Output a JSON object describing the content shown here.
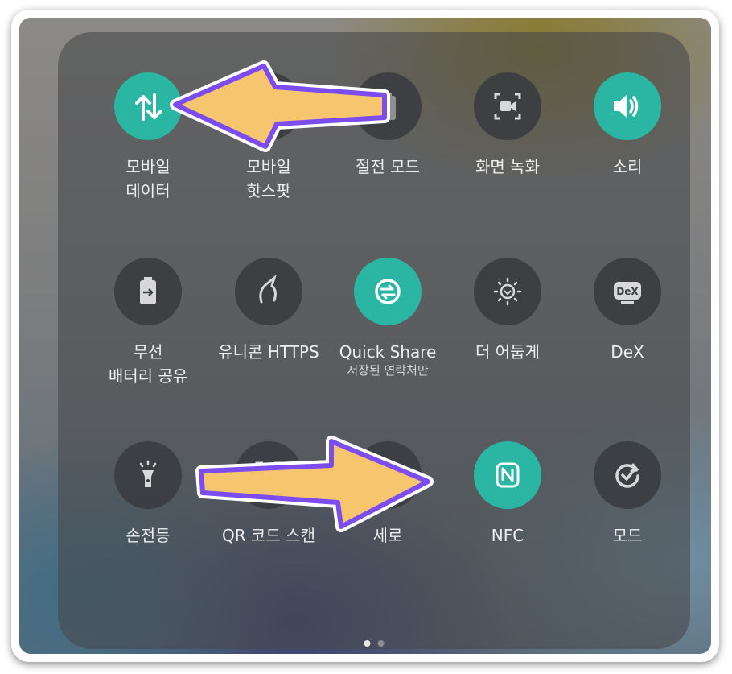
{
  "tiles": [
    {
      "id": "mobile-data",
      "icon": "arrows-up-down-icon",
      "on": true,
      "label": [
        "모바일",
        "데이터"
      ]
    },
    {
      "id": "hotspot",
      "icon": "hotspot-icon",
      "on": false,
      "label": [
        "모바일",
        "핫스팟"
      ]
    },
    {
      "id": "power-saving",
      "icon": "battery-icon",
      "on": false,
      "label": [
        "절전 모드"
      ]
    },
    {
      "id": "screen-record",
      "icon": "screen-record-icon",
      "on": false,
      "label": [
        "화면 녹화"
      ]
    },
    {
      "id": "sound",
      "icon": "speaker-icon",
      "on": true,
      "label": [
        "소리"
      ]
    },
    {
      "id": "wireless-share",
      "icon": "wireless-battery-share-icon",
      "on": false,
      "label": [
        "무선",
        "배터리 공유"
      ]
    },
    {
      "id": "unicorn-https",
      "icon": "unicorn-icon",
      "on": false,
      "label": [
        "유니콘 HTTPS"
      ]
    },
    {
      "id": "quick-share",
      "icon": "quick-share-icon",
      "on": true,
      "label": [
        "Quick Share"
      ],
      "sub": "저장된 연락처만"
    },
    {
      "id": "extra-dim",
      "icon": "extra-dim-icon",
      "on": false,
      "label": [
        "더 어둡게"
      ]
    },
    {
      "id": "dex",
      "icon": "dex-icon",
      "on": false,
      "label": [
        "DeX"
      ]
    },
    {
      "id": "flashlight",
      "icon": "flashlight-icon",
      "on": false,
      "label": [
        "손전등"
      ]
    },
    {
      "id": "qr-scan",
      "icon": "qr-scan-icon",
      "on": false,
      "label": [
        "QR 코드 스캔"
      ]
    },
    {
      "id": "portrait",
      "icon": "rotation-icon",
      "on": false,
      "label": [
        "세로"
      ]
    },
    {
      "id": "nfc",
      "icon": "nfc-icon",
      "on": true,
      "label": [
        "NFC"
      ]
    },
    {
      "id": "modes",
      "icon": "modes-icon",
      "on": false,
      "label": [
        "모드"
      ]
    }
  ],
  "colors": {
    "accent": "#2bb5a3",
    "arrow_fill": "#f6c66e",
    "arrow_stroke": "#7c4cf0"
  },
  "pages": {
    "count": 2,
    "current": 1
  }
}
